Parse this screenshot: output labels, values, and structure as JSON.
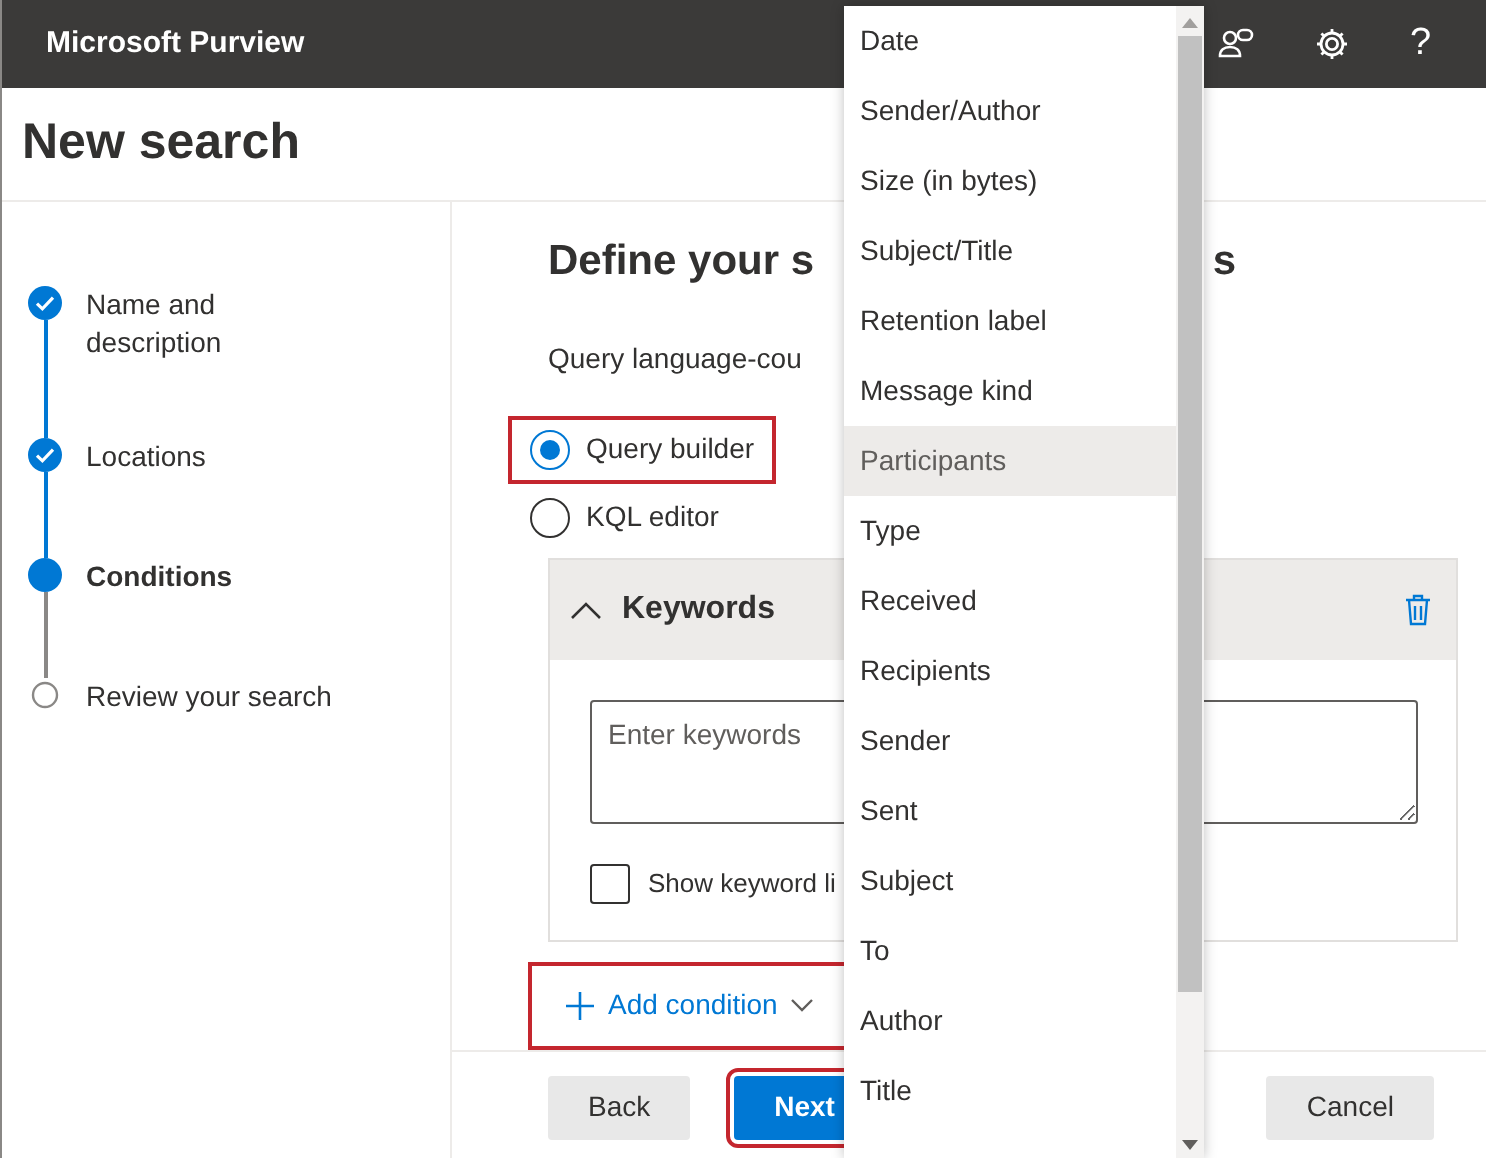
{
  "top_bar": {
    "title": "Microsoft Purview",
    "help": "?"
  },
  "page_title": "New search",
  "steps": [
    {
      "label": "Name and description",
      "kind": "done"
    },
    {
      "label": "Locations",
      "kind": "done"
    },
    {
      "label": "Conditions",
      "kind": "current"
    },
    {
      "label": "Review your search",
      "kind": "pending"
    }
  ],
  "heading": {
    "left": "Define your s",
    "right": "s"
  },
  "query_language": "Query language-cou",
  "query_modes": [
    {
      "label": "Query builder",
      "selected": true,
      "highlighted": true
    },
    {
      "label": "KQL editor",
      "selected": false,
      "highlighted": false
    }
  ],
  "keywords_panel": {
    "title": "Keywords",
    "expanded": true,
    "placeholder": "Enter keywords",
    "checkbox": {
      "label": "Show keyword li",
      "checked": false
    }
  },
  "add_condition": {
    "label": "Add condition",
    "highlighted": true
  },
  "footer": [
    {
      "label": "Back",
      "kind": "secondary",
      "highlighted": false
    },
    {
      "label": "Next",
      "kind": "primary",
      "highlighted": true
    },
    {
      "label": "Cancel",
      "kind": "secondary",
      "highlighted": false
    }
  ],
  "condition_menu": [
    {
      "label": "Date",
      "selected": false
    },
    {
      "label": "Sender/Author",
      "selected": false
    },
    {
      "label": "Size (in bytes)",
      "selected": false
    },
    {
      "label": "Subject/Title",
      "selected": false
    },
    {
      "label": "Retention label",
      "selected": false
    },
    {
      "label": "Message kind",
      "selected": false
    },
    {
      "label": "Participants",
      "selected": true
    },
    {
      "label": "Type",
      "selected": false
    },
    {
      "label": "Received",
      "selected": false
    },
    {
      "label": "Recipients",
      "selected": false
    },
    {
      "label": "Sender",
      "selected": false
    },
    {
      "label": "Sent",
      "selected": false
    },
    {
      "label": "Subject",
      "selected": false
    },
    {
      "label": "To",
      "selected": false
    },
    {
      "label": "Author",
      "selected": false
    },
    {
      "label": "Title",
      "selected": false
    }
  ]
}
